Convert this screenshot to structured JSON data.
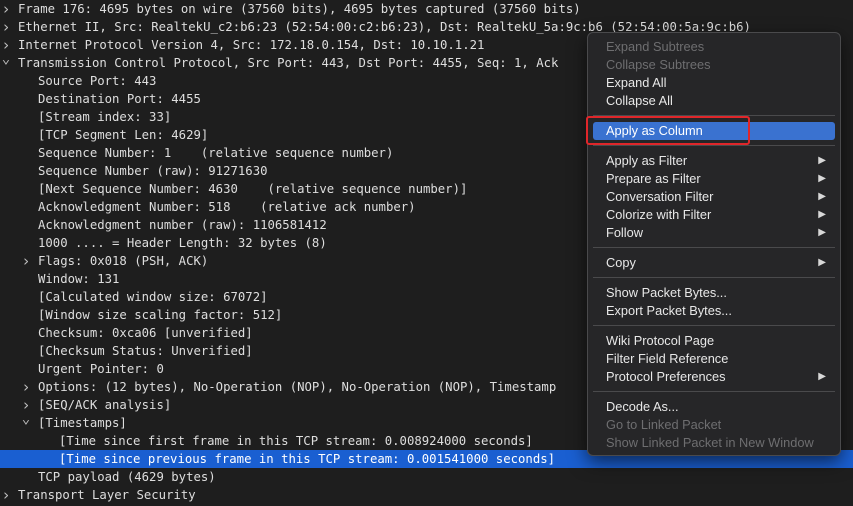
{
  "tree": [
    {
      "text": "Frame 176: 4695 bytes on wire (37560 bits), 4695 bytes captured (37560 bits)",
      "expander": "collapsed",
      "level": 0
    },
    {
      "text": "Ethernet II, Src: RealtekU_c2:b6:23 (52:54:00:c2:b6:23), Dst: RealtekU_5a:9c:b6 (52:54:00:5a:9c:b6)",
      "expander": "collapsed",
      "level": 0
    },
    {
      "text": "Internet Protocol Version 4, Src: 172.18.0.154, Dst: 10.10.1.21",
      "expander": "collapsed",
      "level": 0
    },
    {
      "text": "Transmission Control Protocol, Src Port: 443, Dst Port: 4455, Seq: 1, Ack",
      "expander": "expanded",
      "level": 0
    },
    {
      "text": "Source Port: 443",
      "expander": "none",
      "level": 1
    },
    {
      "text": "Destination Port: 4455",
      "expander": "none",
      "level": 1
    },
    {
      "text": "[Stream index: 33]",
      "expander": "none",
      "level": 1
    },
    {
      "text": "[TCP Segment Len: 4629]",
      "expander": "none",
      "level": 1
    },
    {
      "text": "Sequence Number: 1    (relative sequence number)",
      "expander": "none",
      "level": 1
    },
    {
      "text": "Sequence Number (raw): 91271630",
      "expander": "none",
      "level": 1
    },
    {
      "text": "[Next Sequence Number: 4630    (relative sequence number)]",
      "expander": "none",
      "level": 1
    },
    {
      "text": "Acknowledgment Number: 518    (relative ack number)",
      "expander": "none",
      "level": 1
    },
    {
      "text": "Acknowledgment number (raw): 1106581412",
      "expander": "none",
      "level": 1
    },
    {
      "text": "1000 .... = Header Length: 32 bytes (8)",
      "expander": "none",
      "level": 1
    },
    {
      "text": "Flags: 0x018 (PSH, ACK)",
      "expander": "collapsed",
      "level": 1
    },
    {
      "text": "Window: 131",
      "expander": "none",
      "level": 1
    },
    {
      "text": "[Calculated window size: 67072]",
      "expander": "none",
      "level": 1
    },
    {
      "text": "[Window size scaling factor: 512]",
      "expander": "none",
      "level": 1
    },
    {
      "text": "Checksum: 0xca06 [unverified]",
      "expander": "none",
      "level": 1
    },
    {
      "text": "[Checksum Status: Unverified]",
      "expander": "none",
      "level": 1
    },
    {
      "text": "Urgent Pointer: 0",
      "expander": "none",
      "level": 1
    },
    {
      "text": "Options: (12 bytes), No-Operation (NOP), No-Operation (NOP), Timestamp",
      "expander": "collapsed",
      "level": 1
    },
    {
      "text": "[SEQ/ACK analysis]",
      "expander": "collapsed",
      "level": 1
    },
    {
      "text": "[Timestamps]",
      "expander": "expanded",
      "level": 1
    },
    {
      "text": "[Time since first frame in this TCP stream: 0.008924000 seconds]",
      "expander": "none",
      "level": 2
    },
    {
      "text": "[Time since previous frame in this TCP stream: 0.001541000 seconds]",
      "expander": "none",
      "level": 2,
      "selected": true
    },
    {
      "text": "TCP payload (4629 bytes)",
      "expander": "none",
      "level": 1
    },
    {
      "text": "Transport Layer Security",
      "expander": "collapsed",
      "level": 0
    }
  ],
  "context_menu": {
    "items": [
      {
        "type": "item",
        "label": "Expand Subtrees",
        "disabled": true
      },
      {
        "type": "item",
        "label": "Collapse Subtrees",
        "disabled": true
      },
      {
        "type": "item",
        "label": "Expand All"
      },
      {
        "type": "item",
        "label": "Collapse All"
      },
      {
        "type": "sep"
      },
      {
        "type": "item",
        "label": "Apply as Column",
        "highlighted": true
      },
      {
        "type": "sep"
      },
      {
        "type": "item",
        "label": "Apply as Filter",
        "submenu": true
      },
      {
        "type": "item",
        "label": "Prepare as Filter",
        "submenu": true
      },
      {
        "type": "item",
        "label": "Conversation Filter",
        "submenu": true
      },
      {
        "type": "item",
        "label": "Colorize with Filter",
        "submenu": true
      },
      {
        "type": "item",
        "label": "Follow",
        "submenu": true
      },
      {
        "type": "sep"
      },
      {
        "type": "item",
        "label": "Copy",
        "submenu": true
      },
      {
        "type": "sep"
      },
      {
        "type": "item",
        "label": "Show Packet Bytes..."
      },
      {
        "type": "item",
        "label": "Export Packet Bytes..."
      },
      {
        "type": "sep"
      },
      {
        "type": "item",
        "label": "Wiki Protocol Page"
      },
      {
        "type": "item",
        "label": "Filter Field Reference"
      },
      {
        "type": "item",
        "label": "Protocol Preferences",
        "submenu": true
      },
      {
        "type": "sep"
      },
      {
        "type": "item",
        "label": "Decode As..."
      },
      {
        "type": "item",
        "label": "Go to Linked Packet",
        "disabled": true
      },
      {
        "type": "item",
        "label": "Show Linked Packet in New Window",
        "disabled": true
      }
    ]
  },
  "icons": {
    "collapsed": "chevron-right-icon",
    "expanded": "chevron-down-icon",
    "submenu": "submenu-arrow-icon"
  },
  "colors": {
    "selection": "#1a5fd1",
    "menu_highlight": "#3a72d0",
    "annotation_box": "#e0262a"
  }
}
